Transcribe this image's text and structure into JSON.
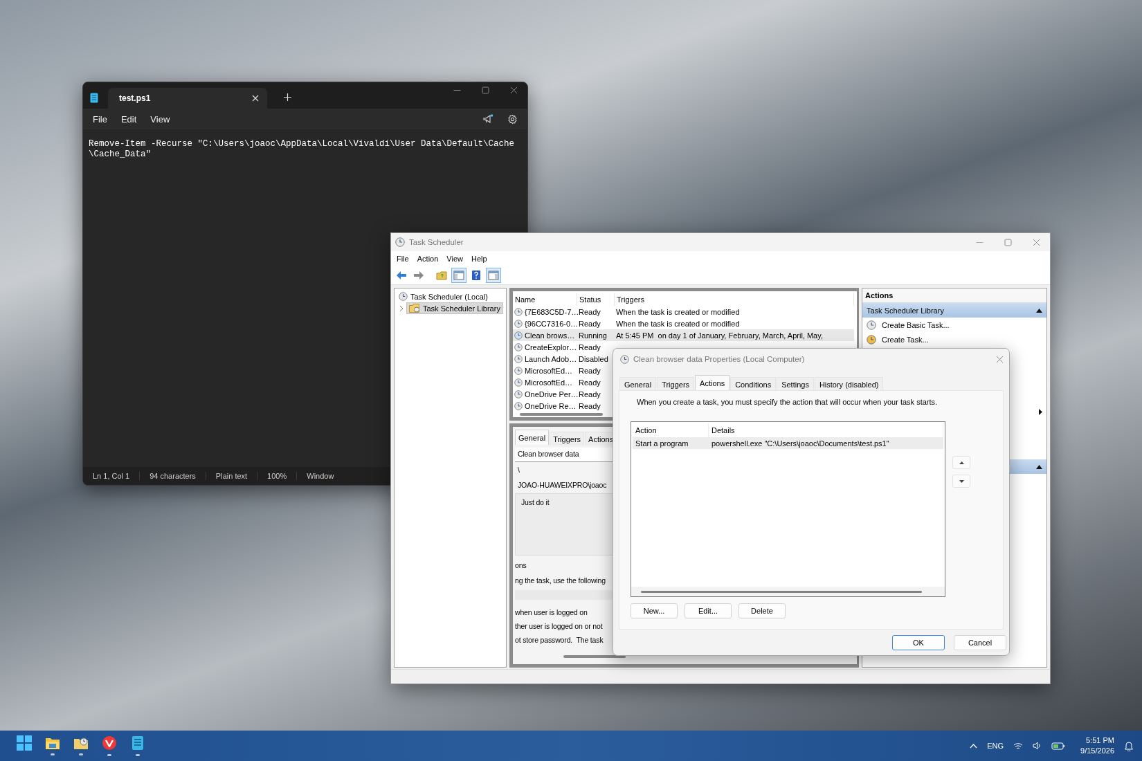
{
  "notepad": {
    "tab": {
      "title": "test.ps1"
    },
    "menu": [
      "File",
      "Edit",
      "View"
    ],
    "lines": [
      "Remove-Item -Recurse \"C:\\Users\\joaoc\\AppData\\Local\\Vivaldi\\User Data\\Default\\Cache",
      "\\Cache_Data\""
    ],
    "status_bar": [
      "Ln 1, Col 1",
      "94 characters",
      "Plain text",
      "100%",
      "Window"
    ]
  },
  "task_scheduler": {
    "title": "Task Scheduler",
    "menu": [
      "File",
      "Action",
      "View",
      "Help"
    ],
    "toolbar": [
      {
        "kind": "back",
        "disabled": false,
        "on": false
      },
      {
        "kind": "forward",
        "disabled": true,
        "on": false
      },
      {
        "kind": "folder",
        "on": false
      },
      {
        "kind": "console-tree",
        "on": true
      },
      {
        "kind": "help",
        "on": false
      },
      {
        "kind": "action-pane",
        "on": true
      }
    ],
    "tree": [
      {
        "label": "Task Scheduler (Local)",
        "selected": false,
        "children": [
          {
            "label": "Task Scheduler Library",
            "selected": true,
            "expanded": false
          }
        ]
      }
    ],
    "task_list": {
      "columns": [
        "Name",
        "Status",
        "Triggers"
      ],
      "rows": [
        {
          "name": "{7E683C5D-7…",
          "status": "Ready",
          "triggers": "When the task is created or modified",
          "selected": false
        },
        {
          "name": "{96CC7316-0…",
          "status": "Ready",
          "triggers": "When the task is created or modified",
          "selected": false
        },
        {
          "name": "Clean brows…",
          "status": "Running",
          "triggers": "At 5:45 PM  on day 1 of January, February, March, April, May,",
          "selected": true
        },
        {
          "name": "CreateExplor…",
          "status": "Ready",
          "selected": false
        },
        {
          "name": "Launch Adob…",
          "status": "Disabled",
          "selected": false
        },
        {
          "name": "MicrosoftEd…",
          "status": "Ready",
          "selected": false
        },
        {
          "name": "MicrosoftEd…",
          "status": "Ready",
          "selected": false
        },
        {
          "name": "OneDrive Per…",
          "status": "Ready",
          "selected": false
        },
        {
          "name": "OneDrive Re…",
          "status": "Ready",
          "selected": false
        }
      ]
    },
    "detail": {
      "tabs": [
        {
          "label": "General",
          "selected": true
        },
        {
          "label": "Triggers",
          "selected": false
        },
        {
          "label": "Actions",
          "selected": false
        }
      ],
      "name": "Clean browser data",
      "location": "\\",
      "author": "JOAO-HUAWEIXPRO\\joaoc",
      "description": "Just do it",
      "section_label": "ons",
      "security_text": "ng the task, use the following",
      "options": [
        "when user is logged on",
        "ther user is logged on or not",
        "ot store password.  The task"
      ]
    },
    "actions_pane": {
      "title": "Actions",
      "sections": [
        {
          "title": "Task Scheduler Library",
          "expanded": true,
          "items": [
            {
              "kind": "item",
              "label": "Create Basic Task..."
            },
            {
              "kind": "item",
              "label": "Create Task..."
            },
            {
              "kind": "submenu"
            }
          ]
        },
        {
          "expanded": true
        }
      ]
    }
  },
  "dialog": {
    "title": "Clean browser data Properties (Local Computer)",
    "tabs": [
      {
        "label": "General",
        "selected": false
      },
      {
        "label": "Triggers",
        "selected": false
      },
      {
        "label": "Actions",
        "selected": true
      },
      {
        "label": "Conditions",
        "selected": false
      },
      {
        "label": "Settings",
        "selected": false
      },
      {
        "label": "History (disabled)",
        "selected": false
      }
    ],
    "intro": "When you create a task, you must specify the action that will occur when your task starts.",
    "table": {
      "columns": [
        "Action",
        "Details"
      ],
      "rows": [
        {
          "action": "Start a program",
          "details": "powershell.exe \"C:\\Users\\joaoc\\Documents\\test.ps1\"",
          "selected": true
        }
      ]
    },
    "buttons": [
      "New...",
      "Edit...",
      "Delete"
    ],
    "footer": [
      {
        "label": "OK",
        "default": true
      },
      {
        "label": "Cancel",
        "default": false
      }
    ]
  },
  "taskbar": {
    "apps": [
      {
        "kind": "start",
        "running": false
      },
      {
        "kind": "explorer",
        "running": true
      },
      {
        "kind": "folder",
        "running": true
      },
      {
        "kind": "vivaldi",
        "running": true
      },
      {
        "kind": "notepad",
        "running": true
      }
    ],
    "language": "ENG",
    "time": "5:51 PM",
    "date": "9/15/2026"
  }
}
